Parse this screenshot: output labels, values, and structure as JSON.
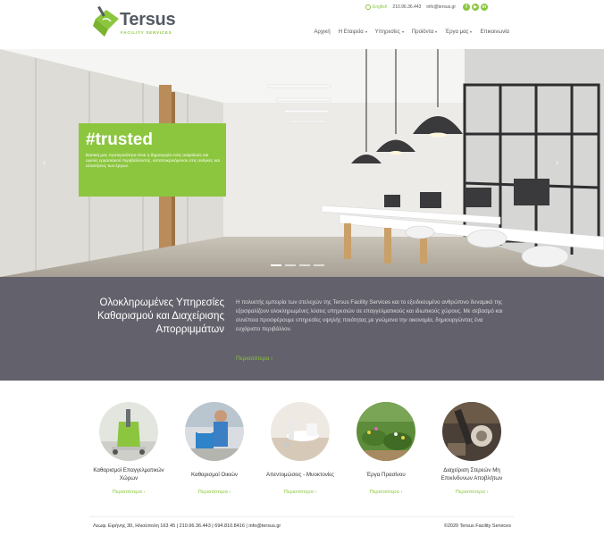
{
  "brand": {
    "name": "Tersus",
    "tagline": "FACILITY SERVICES",
    "accent": "#8cc63f",
    "band_color": "#63616b"
  },
  "topbar": {
    "language": "English",
    "phone": "210.96.36.443",
    "email": "info@tersus.gr",
    "social": [
      "f",
      "▶",
      "in"
    ]
  },
  "nav": {
    "items": [
      "Αρχική",
      "Η Εταιρεία",
      "Υπηρεσίες",
      "Προϊόντα",
      "Έργα μας",
      "Επικοινωνία"
    ]
  },
  "hero": {
    "title": "#trusted",
    "text": "Βασική μας προτεραιότητα είναι η δημιουργία ενός ασφαλούς και υγιούς εργασιακού περιβάλλοντος, ανταποκρινόμενου στις ανάγκες και απαιτήσεις των έργων.",
    "prev_arrow": "‹",
    "next_arrow": "›"
  },
  "intro": {
    "heading": "Ολοκληρωμένες Υπηρεσίες Καθαρισμού και Διαχείρισης Απορριμμάτων",
    "text": "Η πολυετής εμπειρία των στελεχών της Tersus Facility Services και το εξειδικευμένο ανθρώπινο δυναμικό της εξασφαλίζουν ολοκληρωμένες λύσεις υπηρεσιών σε επαγγελματικούς και ιδιωτικούς χώρους. Με σεβασμό και συνέπεια προσφέρουμε υπηρεσίες υψηλής ποιότητας με γνώμονα την οικονομία, δημιουργώντας ένα ευχάριστο περιβάλλον.",
    "more": "Περισσότερα ›"
  },
  "services": [
    {
      "label": "Καθαρισμοί Επαγγελματικών Χώρων",
      "more": "Περισσότερα ›"
    },
    {
      "label": "Καθαρισμοί Οικιών",
      "more": "Περισσότερα ›"
    },
    {
      "label": "Απεντομώσεις - Μυοκτονίες",
      "more": "Περισσότερα ›"
    },
    {
      "label": "Έργα Πρασίνου",
      "more": "Περισσότερα ›"
    },
    {
      "label": "Διαχείριση Στερεών Μη Επικίνδυνων Αποβλήτων",
      "more": "Περισσότερα ›"
    }
  ],
  "footer": {
    "contact": "Λεωφ. Ειρήνης 30, Ηλιούπολη 163 45   |   210.96.36.443   |   694.810.8416   |   info@tersus.gr",
    "copyright": "©2020 Tersus Facility Services"
  }
}
